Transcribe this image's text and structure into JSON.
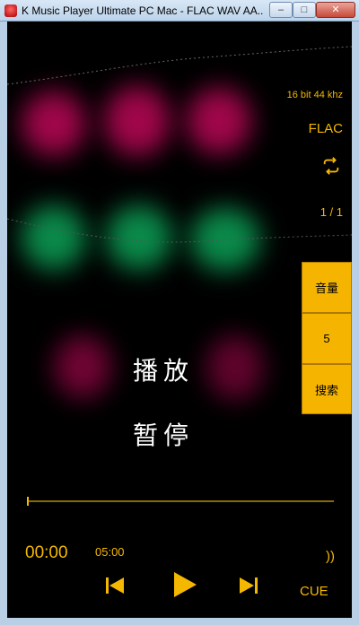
{
  "window": {
    "title": "K Music Player Ultimate PC Mac - FLAC WAV AA...",
    "minimize_label": "–",
    "maximize_label": "□",
    "close_label": "✕"
  },
  "info": {
    "bitrate": "16 bit 44 khz",
    "format": "FLAC",
    "track_count": "1 / 1"
  },
  "side_panel": {
    "volume_label": "音量",
    "volume_value": "5",
    "search_label": "搜索"
  },
  "center": {
    "play_text": "播放",
    "pause_text": "暂停"
  },
  "playback": {
    "current_time": "00:00",
    "total_time": "05:00",
    "progress": 0,
    "cue_label": "CUE"
  },
  "colors": {
    "accent": "#f5b800",
    "pink_blob": "#a0064a",
    "green_blob": "#0a8a4a"
  },
  "icons": [
    "repeat-icon",
    "volume-icon",
    "prev-icon",
    "play-icon",
    "next-icon",
    "menu-icon",
    "folder-icon",
    "player-icon",
    "gear-icon"
  ]
}
